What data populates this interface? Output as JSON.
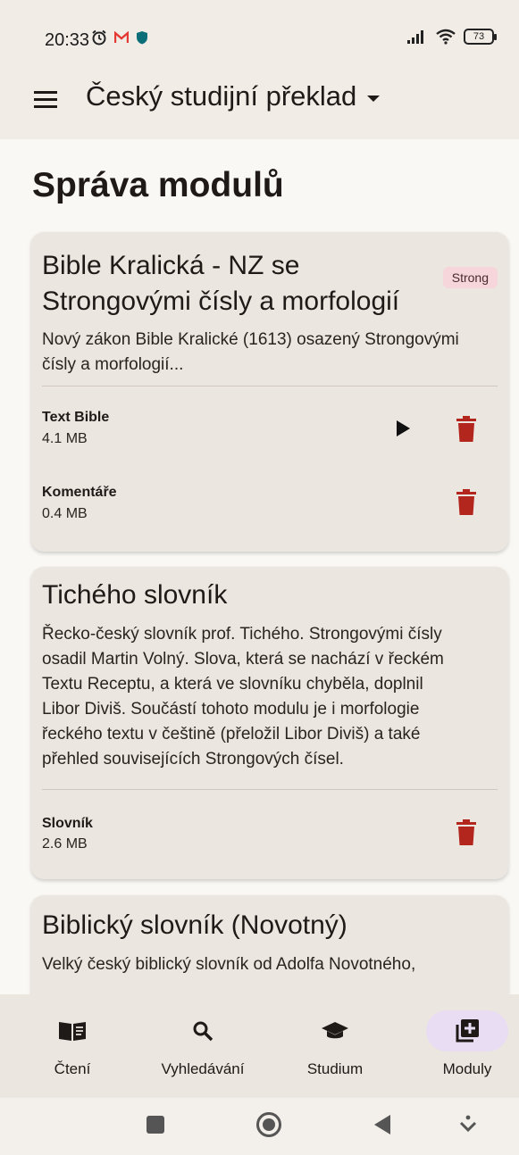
{
  "status_bar": {
    "time": "20:33",
    "battery": "73",
    "icons": [
      "alarm-icon",
      "gmail-icon",
      "vpn-shield-icon",
      "signal-icon",
      "wifi-icon",
      "battery-icon"
    ]
  },
  "app_bar": {
    "title": "Český studijní překlad",
    "menu_icon": "menu-icon",
    "dropdown_icon": "caret-down-icon"
  },
  "page": {
    "title": "Správa modulů"
  },
  "modules": [
    {
      "title_line1": "Bible Kralická - NZ se",
      "title_line2": "Strongovými čísly a morfologií",
      "badge": "Strong",
      "desc_line1": "Nový zákon Bible Kralické (1613) osazený Strongovými",
      "desc_line2": "čísly a morfologií...",
      "rows": [
        {
          "name": "Text Bible",
          "size": "4.1 MB",
          "has_play": true
        },
        {
          "name": "Komentáře",
          "size": "0.4 MB",
          "has_play": false
        }
      ]
    },
    {
      "title": "Tichého slovník",
      "desc_lines": [
        "Řecko-český slovník prof. Tichého. Strongovými čísly",
        "osadil Martin Volný. Slova, která se nachází v řeckém",
        "Textu Receptu, a která ve slovníku chyběla, doplnil",
        "Libor Diviš. Součástí tohoto modulu je i morfologie",
        "řeckého textu v češtině (přeložil Libor Diviš) a také",
        "přehled souvisejících Strongových čísel."
      ],
      "rows": [
        {
          "name": "Slovník",
          "size": "2.6 MB"
        }
      ]
    },
    {
      "title": "Biblický slovník (Novotný)",
      "desc_line1": "Velký český biblický slovník od Adolfa Novotného,"
    }
  ],
  "bottom_nav": {
    "items": [
      {
        "label": "Čtení",
        "icon": "book-icon"
      },
      {
        "label": "Vyhledávání",
        "icon": "search-icon"
      },
      {
        "label": "Studium",
        "icon": "graduation-cap-icon"
      },
      {
        "label": "Moduly",
        "icon": "add-module-icon",
        "active": true
      }
    ]
  },
  "colors": {
    "accent_active": "#e8ddf3",
    "delete": "#b3261e",
    "badge_bg": "#f6d6db"
  }
}
